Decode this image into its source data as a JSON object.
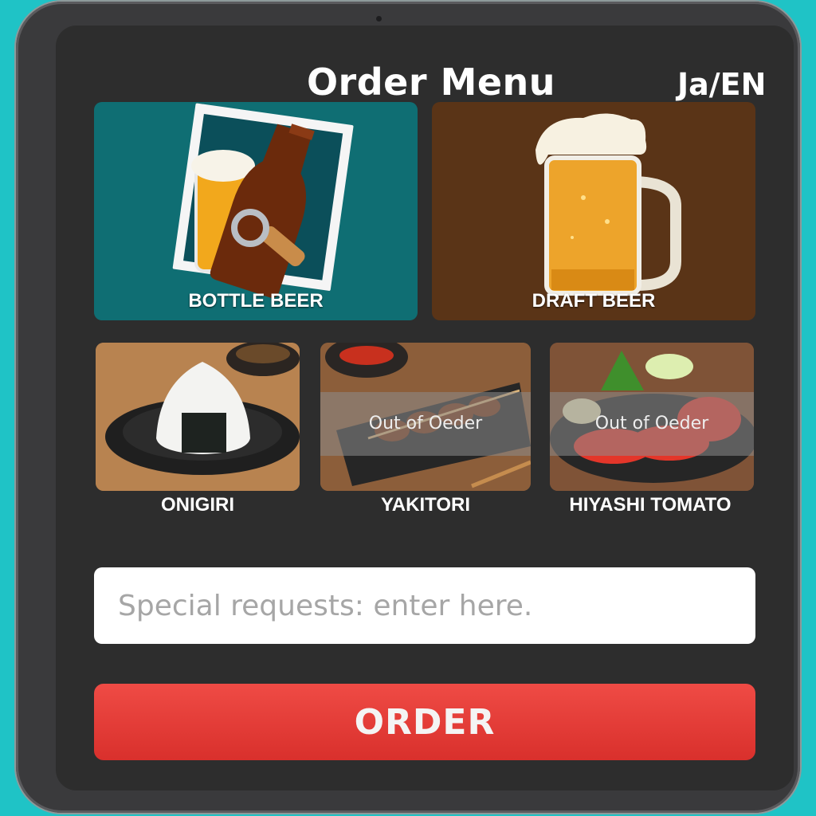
{
  "header": {
    "title": "Order Menu",
    "language_toggle": "Ja/EN"
  },
  "drinks": [
    {
      "label": "BOTTLE BEER",
      "bg": "#0f6e73",
      "icon": "beer-bottle-icon"
    },
    {
      "label": "DRAFT BEER",
      "bg": "#5a3417",
      "icon": "beer-mug-icon"
    }
  ],
  "foods": [
    {
      "label": "ONIGIRI",
      "status": ""
    },
    {
      "label": "YAKITORI",
      "status": "Out of Oeder"
    },
    {
      "label": "HIYASHI TOMATO",
      "status": "Out of Oeder"
    }
  ],
  "request": {
    "placeholder": "Special requests: enter here."
  },
  "order": {
    "label": "ORDER",
    "color": "#e0413c"
  }
}
